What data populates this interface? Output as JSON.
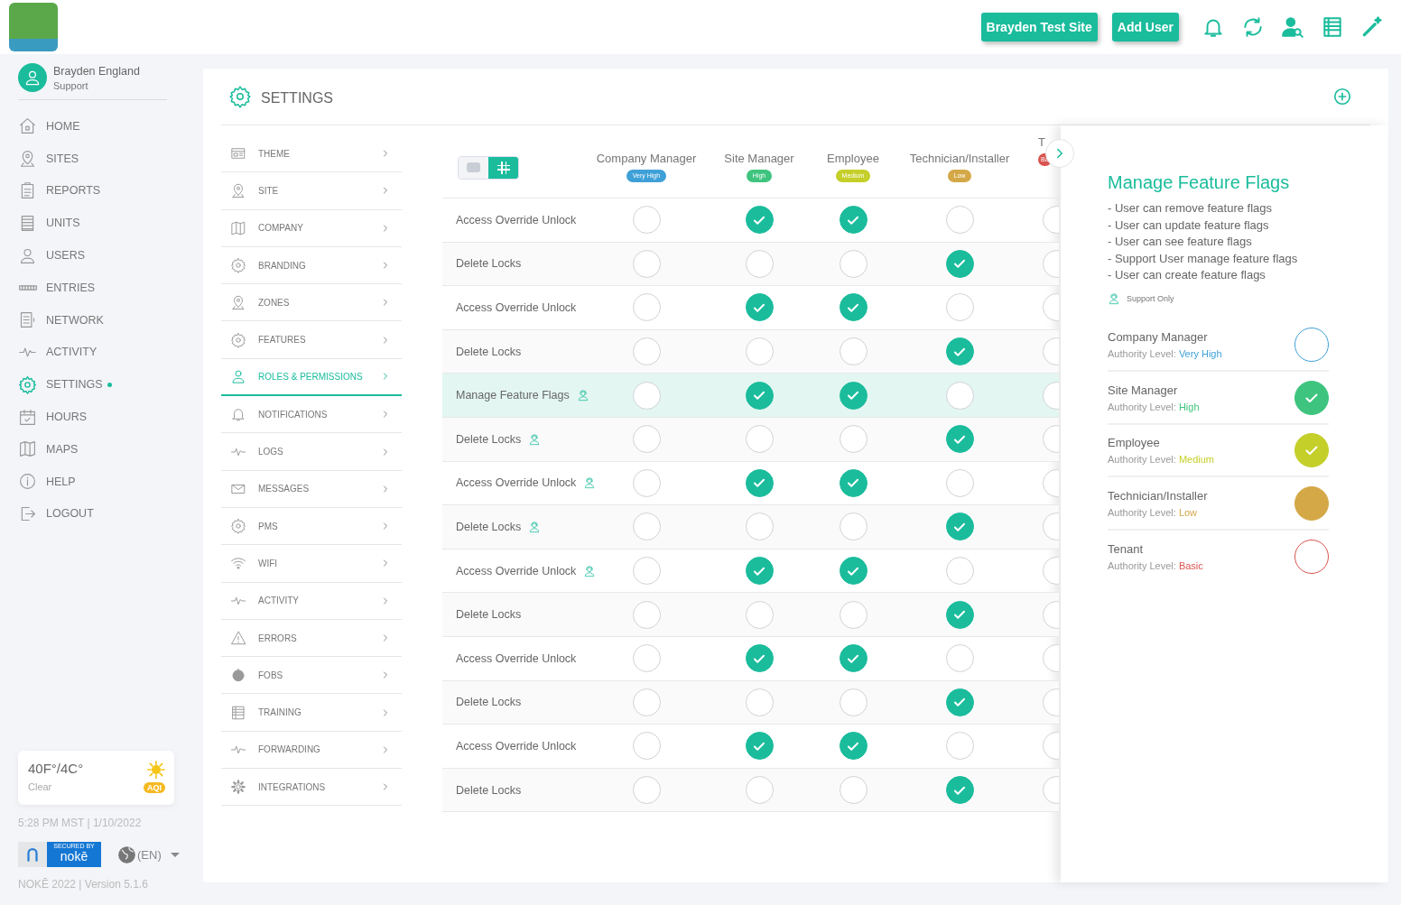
{
  "header": {
    "buttons": [
      "Brayden Test Site",
      "Add User"
    ]
  },
  "user": {
    "name": "Brayden England",
    "role": "Support"
  },
  "nav": [
    {
      "label": "HOME",
      "selected": false
    },
    {
      "label": "SITES",
      "selected": false
    },
    {
      "label": "REPORTS",
      "selected": false
    },
    {
      "label": "UNITS",
      "selected": false
    },
    {
      "label": "USERS",
      "selected": false
    },
    {
      "label": "ENTRIES",
      "selected": false
    },
    {
      "label": "NETWORK",
      "selected": false
    },
    {
      "label": "ACTIVITY",
      "selected": false
    },
    {
      "label": "SETTINGS",
      "selected": true
    },
    {
      "label": "HOURS",
      "selected": false
    },
    {
      "label": "MAPS",
      "selected": false
    },
    {
      "label": "HELP",
      "selected": false
    },
    {
      "label": "LOGOUT",
      "selected": false
    }
  ],
  "weather": {
    "temperature": "40F°/4C°",
    "condition": "Clear",
    "badge": "AQI"
  },
  "timestamp": "5:28 PM MST | 1/10/2022",
  "brand_badge": {
    "caption": "SECURED BY",
    "name": "nokē"
  },
  "language": "(EN)",
  "version": "NOKĒ 2022 | Version 5.1.6",
  "page_title": "SETTINGS",
  "settings_menu": [
    {
      "label": "THEME",
      "selected": false
    },
    {
      "label": "SITE",
      "selected": false
    },
    {
      "label": "COMPANY",
      "selected": false
    },
    {
      "label": "BRANDING",
      "selected": false
    },
    {
      "label": "ZONES",
      "selected": false
    },
    {
      "label": "FEATURES",
      "selected": false
    },
    {
      "label": "ROLES & PERMISSIONS",
      "selected": true
    },
    {
      "label": "NOTIFICATIONS",
      "selected": false
    },
    {
      "label": "LOGS",
      "selected": false
    },
    {
      "label": "MESSAGES",
      "selected": false
    },
    {
      "label": "PMS",
      "selected": false
    },
    {
      "label": "WIFI",
      "selected": false
    },
    {
      "label": "ACTIVITY",
      "selected": false
    },
    {
      "label": "ERRORS",
      "selected": false
    },
    {
      "label": "FOBS",
      "selected": false
    },
    {
      "label": "TRAINING",
      "selected": false
    },
    {
      "label": "FORWARDING",
      "selected": false
    },
    {
      "label": "INTEGRATIONS",
      "selected": false
    }
  ],
  "view_toggle": [
    {
      "kind": "cards",
      "selected": false
    },
    {
      "kind": "grid",
      "selected": true
    }
  ],
  "roles": [
    {
      "name": "Company Manager",
      "level": "Very High",
      "color": "#3fa0d8"
    },
    {
      "name": "Site Manager",
      "level": "High",
      "color": "#3ec47e"
    },
    {
      "name": "Employee",
      "level": "Medium",
      "color": "#c5cf2a"
    },
    {
      "name": "Technician/Installer",
      "level": "Low",
      "color": "#d4a847"
    },
    {
      "name": "T",
      "level": "Ba",
      "color": "#d9534f"
    }
  ],
  "permissions": [
    {
      "label": "Access Override Unlock",
      "support_only": false,
      "selected": false,
      "cells": [
        false,
        true,
        true,
        false,
        false
      ]
    },
    {
      "label": "Delete Locks",
      "support_only": false,
      "selected": false,
      "cells": [
        false,
        false,
        false,
        true,
        false
      ]
    },
    {
      "label": "Access Override Unlock",
      "support_only": false,
      "selected": false,
      "cells": [
        false,
        true,
        true,
        false,
        false
      ]
    },
    {
      "label": "Delete Locks",
      "support_only": false,
      "selected": false,
      "cells": [
        false,
        false,
        false,
        true,
        false
      ]
    },
    {
      "label": "Manage Feature Flags",
      "support_only": true,
      "selected": true,
      "cells": [
        false,
        true,
        true,
        false,
        false
      ]
    },
    {
      "label": "Delete Locks",
      "support_only": true,
      "selected": false,
      "cells": [
        false,
        false,
        false,
        true,
        false
      ]
    },
    {
      "label": "Access Override Unlock",
      "support_only": true,
      "selected": false,
      "cells": [
        false,
        true,
        true,
        false,
        false
      ]
    },
    {
      "label": "Delete Locks",
      "support_only": true,
      "selected": false,
      "cells": [
        false,
        false,
        false,
        true,
        false
      ]
    },
    {
      "label": "Access Override Unlock",
      "support_only": true,
      "selected": false,
      "cells": [
        false,
        true,
        true,
        false,
        false
      ]
    },
    {
      "label": "Delete Locks",
      "support_only": false,
      "selected": false,
      "cells": [
        false,
        false,
        false,
        true,
        false
      ]
    },
    {
      "label": "Access Override Unlock",
      "support_only": false,
      "selected": false,
      "cells": [
        false,
        true,
        true,
        false,
        false
      ]
    },
    {
      "label": "Delete Locks",
      "support_only": false,
      "selected": false,
      "cells": [
        false,
        false,
        false,
        true,
        false
      ]
    },
    {
      "label": "Access Override Unlock",
      "support_only": false,
      "selected": false,
      "cells": [
        false,
        true,
        true,
        false,
        false
      ]
    },
    {
      "label": "Delete Locks",
      "support_only": false,
      "selected": false,
      "cells": [
        false,
        false,
        false,
        true,
        false
      ]
    }
  ],
  "detail": {
    "title": "Manage Feature Flags",
    "bullets": [
      "- User can remove feature flags",
      "- User can update feature flags",
      "- User can see feature flags",
      "- Support User manage feature flags",
      "- User can create feature flags"
    ],
    "support_label": "Support Only",
    "roles": [
      {
        "name": "Company Manager",
        "level_label": "Authority Level:",
        "level": "Very High",
        "color": "#3fa0d8",
        "filled": false,
        "checked": false
      },
      {
        "name": "Site Manager",
        "level_label": "Authority Level:",
        "level": "High",
        "color": "#3ec47e",
        "filled": true,
        "checked": true
      },
      {
        "name": "Employee",
        "level_label": "Authority Level:",
        "level": "Medium",
        "color": "#c5cf2a",
        "filled": true,
        "checked": true
      },
      {
        "name": "Technician/Installer",
        "level_label": "Authority Level:",
        "level": "Low",
        "color": "#d4a847",
        "filled": true,
        "checked": false
      },
      {
        "name": "Tenant",
        "level_label": "Authority Level:",
        "level": "Basic",
        "color": "#d9534f",
        "filled": false,
        "checked": false
      }
    ]
  }
}
